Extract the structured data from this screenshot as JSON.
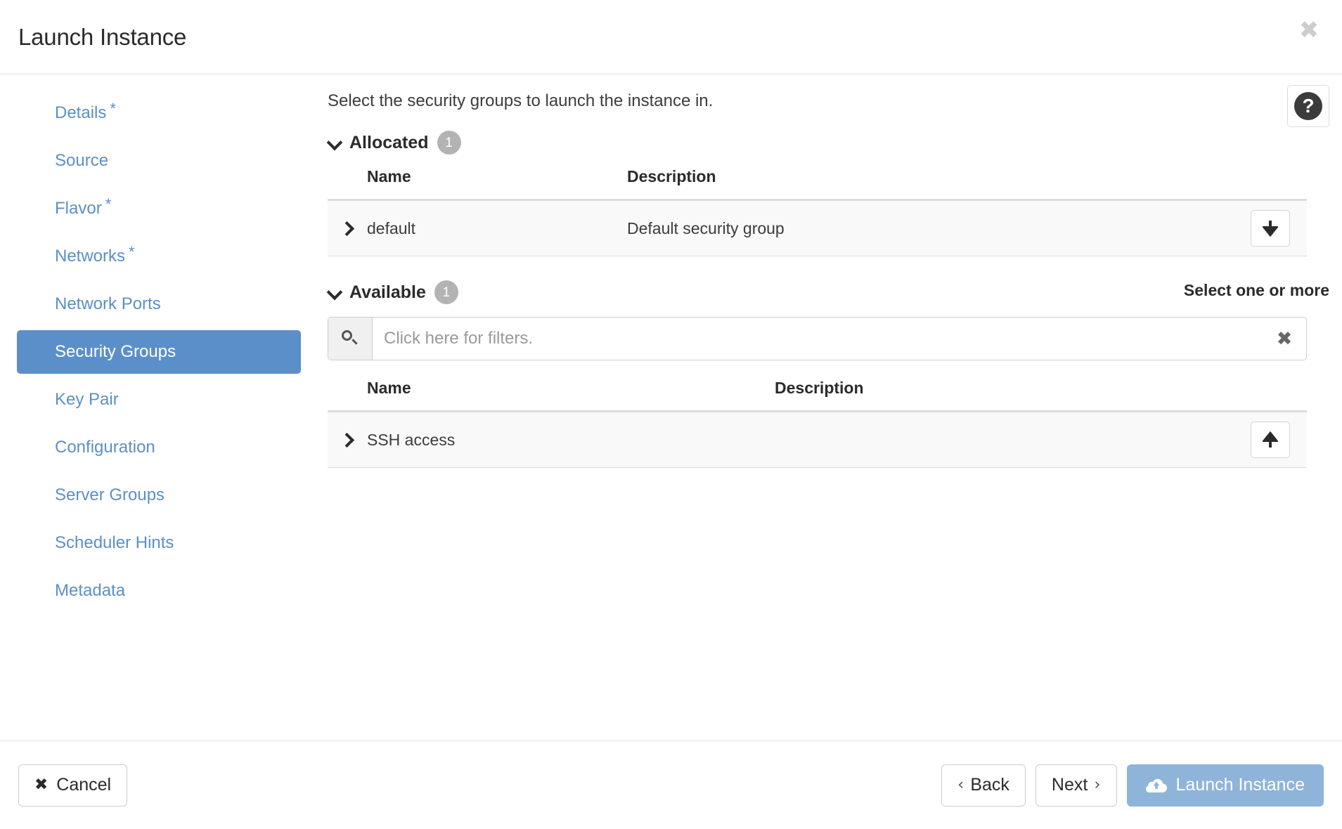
{
  "window": {
    "title": "Launch Instance",
    "close_label": "✖"
  },
  "sidebar": {
    "items": [
      {
        "label": "Details",
        "required": "*",
        "active": false
      },
      {
        "label": "Source",
        "required": "",
        "active": false
      },
      {
        "label": "Flavor",
        "required": "*",
        "active": false
      },
      {
        "label": "Networks",
        "required": "*",
        "active": false
      },
      {
        "label": "Network Ports",
        "required": "",
        "active": false
      },
      {
        "label": "Security Groups",
        "required": "",
        "active": true
      },
      {
        "label": "Key Pair",
        "required": "",
        "active": false
      },
      {
        "label": "Configuration",
        "required": "",
        "active": false
      },
      {
        "label": "Server Groups",
        "required": "",
        "active": false
      },
      {
        "label": "Scheduler Hints",
        "required": "",
        "active": false
      },
      {
        "label": "Metadata",
        "required": "",
        "active": false
      }
    ]
  },
  "main": {
    "instruction": "Select the security groups to launch the instance in.",
    "help_label": "?",
    "allocated": {
      "title": "Allocated",
      "count": "1",
      "columns": {
        "name": "Name",
        "description": "Description"
      },
      "rows": [
        {
          "name": "default",
          "description": "Default security group",
          "action_icon": "arrow-down"
        }
      ]
    },
    "available": {
      "title": "Available",
      "count": "1",
      "select_hint": "Select one or more",
      "filter": {
        "placeholder": "Click here for filters.",
        "value": "",
        "clear_label": "✖"
      },
      "columns": {
        "name": "Name",
        "description": "Description"
      },
      "rows": [
        {
          "name": "SSH access",
          "description": "",
          "action_icon": "arrow-up"
        }
      ]
    }
  },
  "footer": {
    "cancel": {
      "label": "Cancel",
      "icon": "✖"
    },
    "back": {
      "label": "Back",
      "icon": "‹"
    },
    "next": {
      "label": "Next",
      "icon": "›"
    },
    "launch": {
      "label": "Launch Instance",
      "icon": "cloud-upload-icon"
    }
  },
  "colors": {
    "accent": "#5b8fc9",
    "launch_button": "#8fb4d9",
    "badge": "#b3b3b3",
    "row_bg": "#f9f9f9"
  }
}
